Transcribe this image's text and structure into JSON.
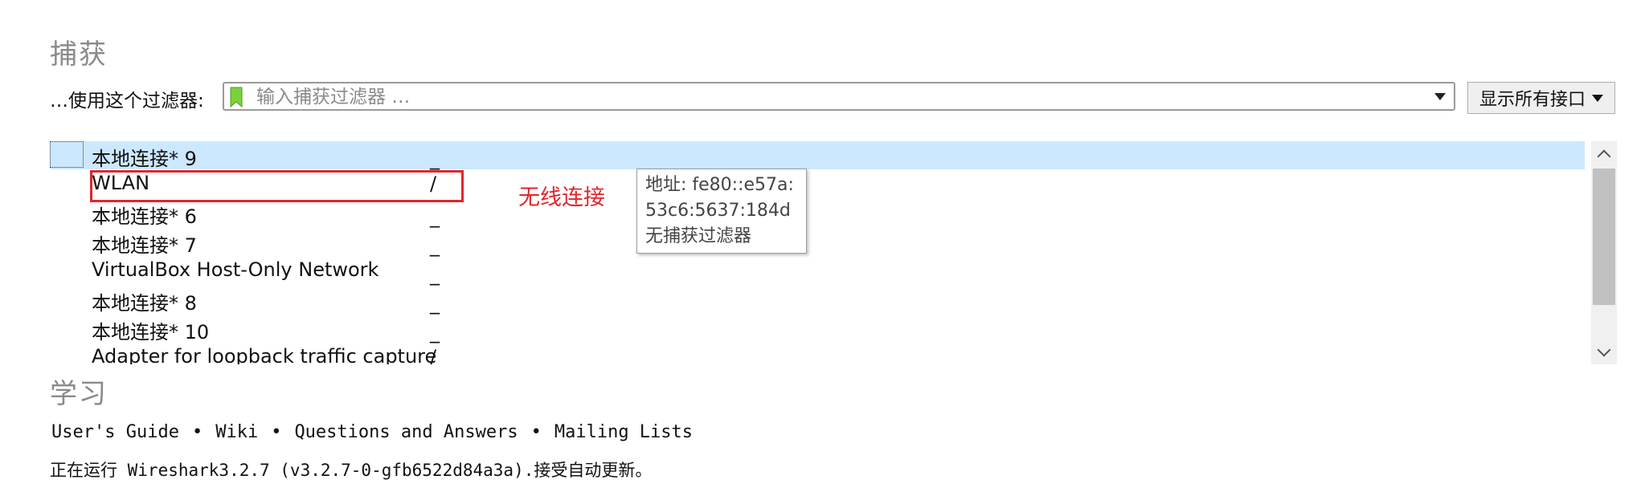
{
  "capture": {
    "title": "捕获",
    "filter_label": "…使用这个过滤器:",
    "filter_placeholder": "输入捕获过滤器 …",
    "interfaces_button": "显示所有接口"
  },
  "interfaces": [
    {
      "name": "本地连接* 9",
      "traffic": "_",
      "selected": true
    },
    {
      "name": "WLAN",
      "traffic": "/"
    },
    {
      "name": "本地连接* 6",
      "traffic": "_"
    },
    {
      "name": "本地连接* 7",
      "traffic": "_"
    },
    {
      "name": "VirtualBox Host-Only Network",
      "traffic": "_"
    },
    {
      "name": "本地连接* 8",
      "traffic": "_"
    },
    {
      "name": "本地连接* 10",
      "traffic": "_"
    },
    {
      "name": "Adapter for loopback traffic capture",
      "traffic": "/"
    }
  ],
  "annotation": "无线连接",
  "tooltip": {
    "line1": "地址: fe80::e57a:",
    "line2": "53c6:5637:184d",
    "line3": "无捕获过滤器"
  },
  "learn": {
    "title": "学习",
    "links": [
      "User's Guide",
      "Wiki",
      "Questions and Answers",
      "Mailing Lists"
    ],
    "separator": "•",
    "status": "正在运行 Wireshark3.2.7 (v3.2.7-0-gfb6522d84a3a).接受自动更新。"
  },
  "colors": {
    "selection": "#cce8ff",
    "highlight": "#e0262c",
    "bookmark": "#7bd13b"
  }
}
